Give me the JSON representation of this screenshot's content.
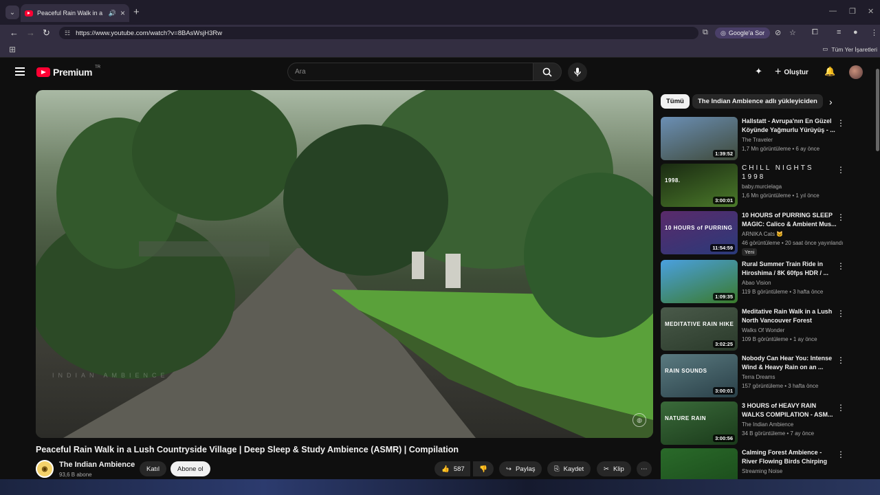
{
  "browser": {
    "tab_title": "Peaceful Rain Walk in a Lush",
    "url": "https://www.youtube.com/watch?v=8BAsWsjH3Rw",
    "ask_google_label": "Google'a Sor",
    "all_bookmarks_label": "Tüm Yer İşaretleri"
  },
  "youtube": {
    "logo_text": "Premium",
    "logo_country": "TR",
    "search_placeholder": "Ara",
    "create_label": "Oluştur"
  },
  "video": {
    "title": "Peaceful Rain Walk in a Lush Countryside Village | Deep Sleep & Study Ambience (ASMR) | Compilation",
    "watermark": "INDIAN AMBIENCE",
    "channel_name": "The Indian Ambience",
    "subscribers": "93,6 B abone",
    "join_label": "Katıl",
    "subscribe_label": "Abone ol",
    "likes": "587",
    "share_label": "Paylaş",
    "save_label": "Kaydet",
    "clip_label": "Klip"
  },
  "chips": [
    {
      "label": "Tümü"
    },
    {
      "label": "The Indian Ambience adlı yükleyiciden"
    }
  ],
  "recommendations": [
    {
      "title": "Hallstatt - Avrupa'nın En Güzel Köyünde Yağmurlu Yürüyüş - ...",
      "channel": "The Traveler",
      "meta": "1,7 Mn görüntüleme • 6 ay önce",
      "duration": "1:39:52",
      "thumb_text": "",
      "color1": "#6b8fb5",
      "color2": "#3f4a3a"
    },
    {
      "title": "CHILL NIGHTS 1998",
      "channel": "baby.murcielaga",
      "meta": "1,6 Mn görüntüleme • 1 yıl önce",
      "duration": "3:00:01",
      "thumb_text": "1998.",
      "color1": "#1a2a12",
      "color2": "#4b7a2a"
    },
    {
      "title": "10 HOURS of PURRING SLEEP MAGIC: Calico & Ambient Mus...",
      "channel": "ARNIKA Cats 🐱",
      "meta": "46 görüntüleme • 20 saat önce yayınlandı",
      "badge": "Yeni",
      "duration": "11:54:59",
      "thumb_text": "10 HOURS of PURRING",
      "color1": "#5a2a6a",
      "color2": "#2a3a7a"
    },
    {
      "title": "Rural Summer Train Ride in Hiroshima / 8K 60fps HDR / ...",
      "channel": "Abao Vision",
      "meta": "119 B görüntüleme • 3 hafta önce",
      "duration": "1:09:35",
      "thumb_text": "",
      "color1": "#4aa0e0",
      "color2": "#3a7a2a"
    },
    {
      "title": "Meditative Rain Walk in a Lush North Vancouver Forest",
      "channel": "Walks Of Wonder",
      "meta": "109 B görüntüleme • 1 ay önce",
      "duration": "3:02:25",
      "thumb_text": "MEDITATIVE RAIN HIKE",
      "color1": "#4a5a4a",
      "color2": "#2a3a2a"
    },
    {
      "title": "Nobody Can Hear You: Intense Wind & Heavy Rain on an ...",
      "channel": "Terra Dreams",
      "meta": "157 görüntüleme • 3 hafta önce",
      "duration": "3:00:01",
      "thumb_text": "RAIN SOUNDS",
      "color1": "#5a7a80",
      "color2": "#2a4048"
    },
    {
      "title": "3 HOURS of HEAVY RAIN WALKS COMPILATION - ASM...",
      "channel": "The Indian Ambience",
      "meta": "34 B görüntüleme • 7 ay önce",
      "duration": "3:00:56",
      "thumb_text": "NATURE RAIN",
      "color1": "#3a6a3a",
      "color2": "#1a3a1a"
    },
    {
      "title": "Calming Forest Ambience - River Flowing Birds Chirping in...",
      "channel": "Streaming Noise",
      "meta": "",
      "duration": "",
      "thumb_text": "",
      "color1": "#2a6a2a",
      "color2": "#1a4a1a"
    }
  ]
}
